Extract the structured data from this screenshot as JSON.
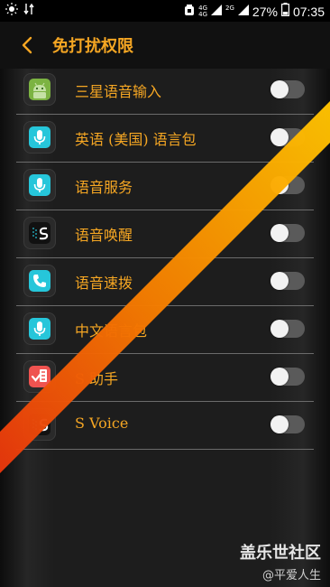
{
  "status_bar": {
    "network_top": "4G",
    "network_bottom": "4G",
    "network_sub": "2G",
    "battery": "27%",
    "time": "07:35"
  },
  "header": {
    "title": "免打扰权限",
    "back_icon": "chevron-left-icon"
  },
  "colors": {
    "accent": "#f5a623",
    "background": "#1d1d1d",
    "divider": "#6b6b6b",
    "toggle_off": "#5a5a5a"
  },
  "apps": [
    {
      "label": "三星语音输入",
      "icon": "android-icon",
      "enabled": false
    },
    {
      "label": "英语 (美国) 语言包",
      "icon": "microphone-icon",
      "enabled": false
    },
    {
      "label": "语音服务",
      "icon": "microphone-icon",
      "enabled": false
    },
    {
      "label": "语音唤醒",
      "icon": "s-voice-icon",
      "enabled": false
    },
    {
      "label": "语音速拨",
      "icon": "phone-icon",
      "enabled": false
    },
    {
      "label": "中文语言包",
      "icon": "microphone-icon",
      "enabled": false
    },
    {
      "label": "S 助手",
      "icon": "s-assistant-icon",
      "enabled": false
    },
    {
      "label": "S Voice",
      "icon": "s-voice-icon",
      "enabled": false
    }
  ],
  "watermark": {
    "brand": "盖乐世社区",
    "user": "@平爱人生"
  }
}
